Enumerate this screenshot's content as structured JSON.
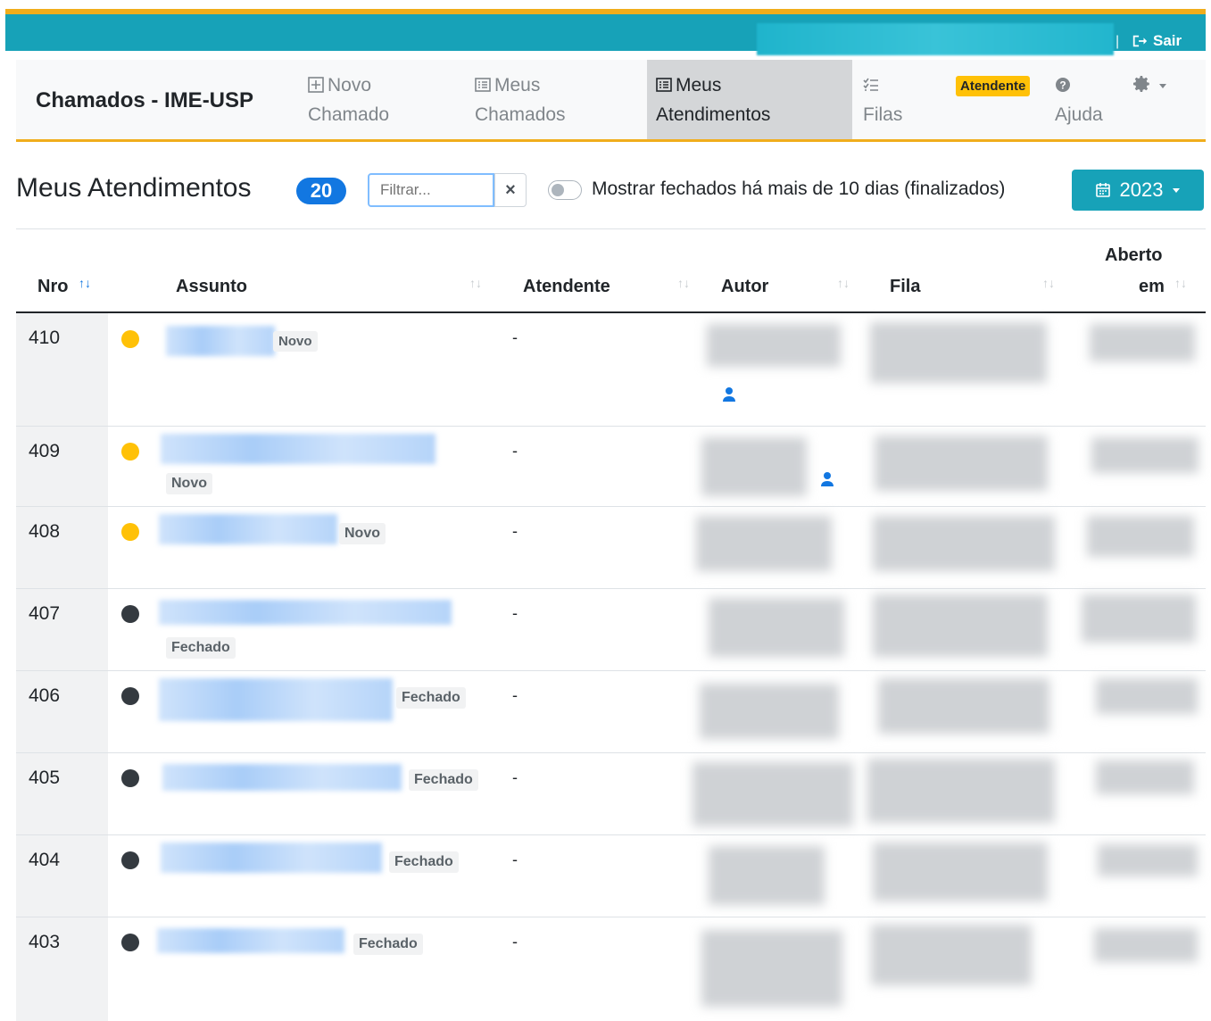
{
  "topbar": {
    "separator": "|",
    "logout_label": "Sair"
  },
  "nav": {
    "brand": "Chamados - IME-USP",
    "items": [
      {
        "line1": "Novo",
        "line2": "Chamado"
      },
      {
        "line1": "Meus",
        "line2": "Chamados"
      },
      {
        "line1": "Meus",
        "line2": "Atendimentos"
      },
      {
        "line1": "",
        "line2": "Filas"
      },
      {
        "line1": "",
        "line2": "Ajuda"
      }
    ],
    "role_badge": "Atendente"
  },
  "page": {
    "title": "Meus Atendimentos",
    "count": "20",
    "filter_placeholder": "Filtrar...",
    "clear_symbol": "×",
    "toggle_label": "Mostrar fechados há mais de 10 dias (finalizados)",
    "year": "2023"
  },
  "table": {
    "headers": {
      "nro": "Nro",
      "assunto": "Assunto",
      "atendente": "Atendente",
      "autor": "Autor",
      "fila": "Fila",
      "aberto_line1": "Aberto",
      "aberto_line2": "em"
    },
    "rows": [
      {
        "nro": "410",
        "status": "Novo",
        "atendente": "-"
      },
      {
        "nro": "409",
        "status": "Novo",
        "atendente": "-"
      },
      {
        "nro": "408",
        "status": "Novo",
        "atendente": "-"
      },
      {
        "nro": "407",
        "status": "Fechado",
        "atendente": "-"
      },
      {
        "nro": "406",
        "status": "Fechado",
        "atendente": "-"
      },
      {
        "nro": "405",
        "status": "Fechado",
        "atendente": "-"
      },
      {
        "nro": "404",
        "status": "Fechado",
        "atendente": "-"
      },
      {
        "nro": "403",
        "status": "Fechado",
        "atendente": "-"
      }
    ]
  },
  "colors": {
    "accent": "#17a2b8",
    "warning": "#ffc107",
    "primary": "#1277e1",
    "open_dot": "#ffc107",
    "closed_dot": "#343a40"
  }
}
